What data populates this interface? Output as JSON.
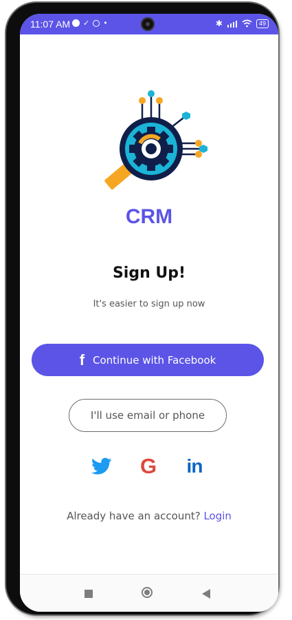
{
  "status_bar": {
    "time": "11:07 AM",
    "battery": "49"
  },
  "app": {
    "title": "CRM"
  },
  "signup": {
    "heading": "Sign Up!",
    "subheading": "It's easier to sign up now",
    "facebook_button": "Continue with Facebook",
    "email_button": "I'll use email or phone",
    "social": [
      "twitter-icon",
      "google-icon",
      "linkedin-icon"
    ],
    "have_account_text": "Already have an account?",
    "login_link": "Login"
  },
  "colors": {
    "primary": "#5b54e6",
    "logo_navy": "#0f1f4a",
    "logo_orange": "#f5a623",
    "logo_cyan": "#1bb3d6",
    "twitter": "#1d9bf0",
    "google": "#dc4a3d",
    "linkedin": "#0a66c2"
  }
}
